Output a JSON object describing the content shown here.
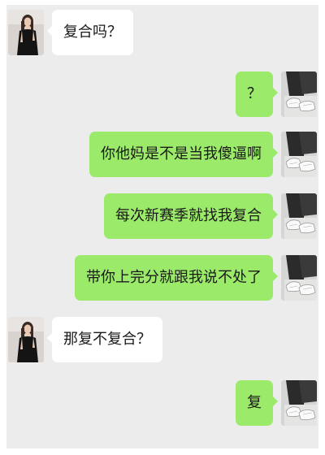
{
  "colors": {
    "chat_background": "#ececec",
    "incoming_bubble": "#ffffff",
    "outgoing_bubble": "#9bea6a",
    "text": "#1a1a1a"
  },
  "messages": [
    {
      "side": "incoming",
      "text": "复合吗？",
      "avatar": "woman-in-black-dress-avatar"
    },
    {
      "side": "outgoing",
      "text": "？",
      "avatar": "sneakers-avatar"
    },
    {
      "side": "outgoing",
      "text": "你他妈是不是当我傻逼啊",
      "avatar": "sneakers-avatar"
    },
    {
      "side": "outgoing",
      "text": "每次新赛季就找我复合",
      "avatar": "sneakers-avatar"
    },
    {
      "side": "outgoing",
      "text": "带你上完分就跟我说不处了",
      "avatar": "sneakers-avatar"
    },
    {
      "side": "incoming",
      "text": "那复不复合？",
      "avatar": "woman-in-black-dress-avatar"
    },
    {
      "side": "outgoing",
      "text": "复",
      "avatar": "sneakers-avatar"
    }
  ]
}
